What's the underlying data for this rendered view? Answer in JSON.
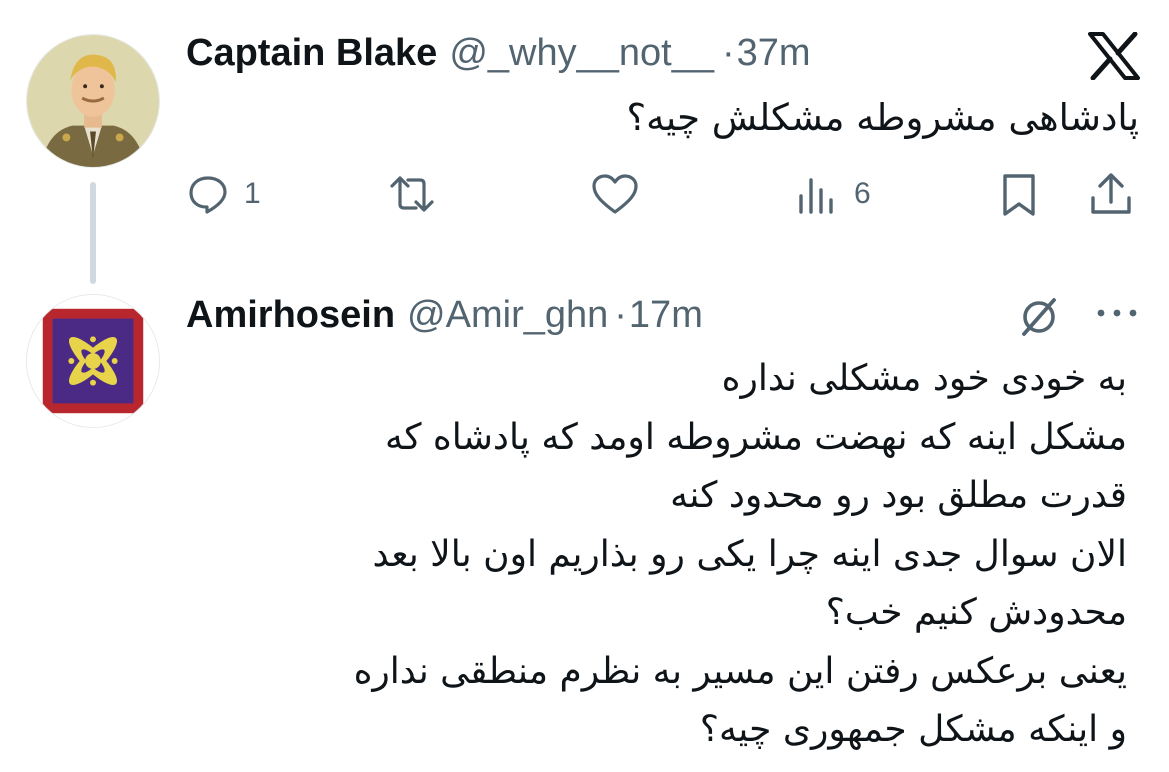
{
  "tweet1": {
    "display_name": "Captain Blake",
    "handle": "@_why__not__",
    "separator": "·",
    "time": "37m",
    "text": "پادشاهی مشروطه مشکلش چیه؟",
    "actions": {
      "reply_count": "1",
      "views_count": "6"
    }
  },
  "tweet2": {
    "display_name": "Amirhosein",
    "handle": "@Amir_ghn",
    "separator": "·",
    "time": "17m",
    "lines": [
      "به خودی خود مشکلی نداره",
      "مشکل اینه که نهضت مشروطه اومد که پادشاه که",
      "قدرت مطلق بود رو محدود کنه",
      "الان سوال جدی اینه چرا یکی رو بذاریم اون بالا بعد",
      "محدودش کنیم خب؟",
      "یعنی برعکس رفتن این مسیر به نظرم منطقی نداره",
      "و اینکه مشکل جمهوری چیه؟"
    ]
  },
  "icons": {
    "brand": "x-logo-icon",
    "reply": "reply-icon",
    "repost": "repost-icon",
    "like": "like-icon",
    "views": "views-icon",
    "bookmark": "bookmark-icon",
    "share": "share-icon",
    "grok": "grok-icon",
    "more": "more-icon"
  },
  "colors": {
    "text": "#0f1419",
    "muted": "#536471",
    "thread_line": "#cfd9de",
    "flag_red": "#b8262e",
    "flag_purple": "#4b2a86",
    "flag_yellow": "#e8d44a"
  }
}
